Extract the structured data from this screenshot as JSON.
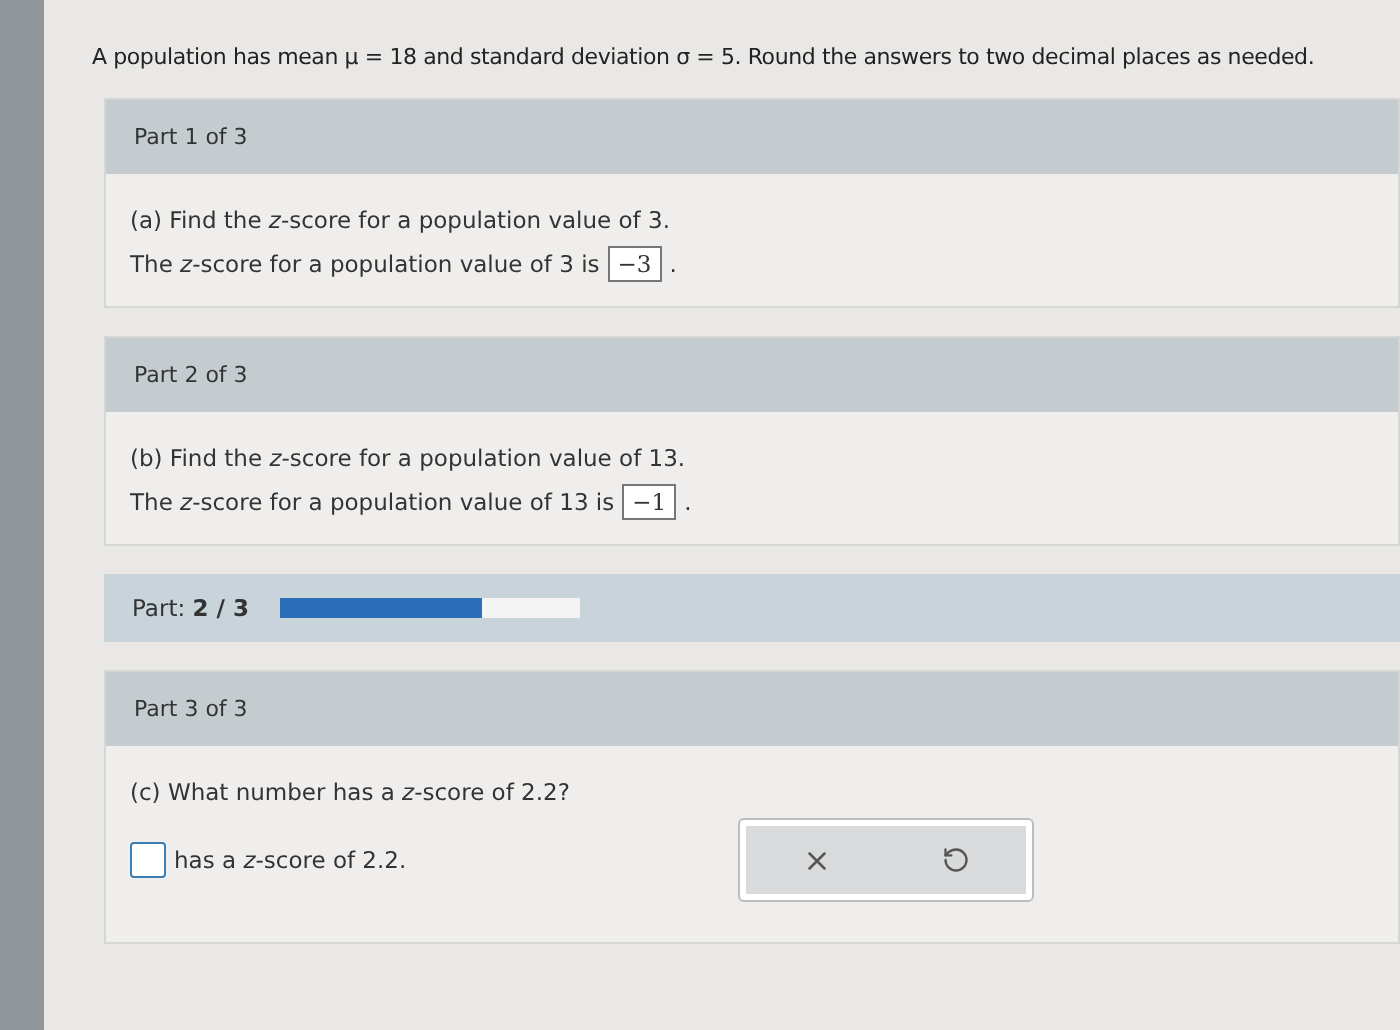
{
  "intro": "A population has mean μ = 18 and standard deviation σ = 5. Round the answers to two decimal places as needed.",
  "parts": [
    {
      "kind": "answered",
      "header": "Part 1 of 3",
      "question": "(a) Find the *z*-score for a population value of 3.",
      "answer_before": "The *z*-score for a population value of 3 is",
      "answer_value": "−3",
      "answer_after": "."
    },
    {
      "kind": "answered",
      "header": "Part 2 of 3",
      "question": "(b) Find the *z*-score for a population value of 13.",
      "answer_before": "The *z*-score for a population value of 13 is",
      "answer_value": "−1",
      "answer_after": "."
    },
    {
      "kind": "progress",
      "label": "Part:",
      "value": "2 / 3",
      "level": 0.67
    },
    {
      "kind": "open",
      "header": "Part 3 of 3",
      "question": "(c) What number has a *z*-score of 2.2?",
      "answer_after": "has a *z*-score of 2.2."
    }
  ]
}
